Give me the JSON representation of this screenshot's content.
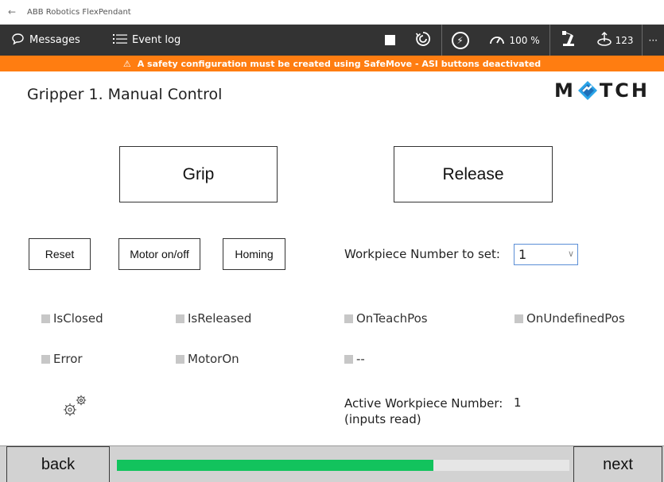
{
  "window": {
    "title": "ABB Robotics FlexPendant",
    "back_glyph": "←"
  },
  "commandbar": {
    "messages_label": "Messages",
    "messages_icon": "speech-bubble-icon",
    "eventlog_label": "Event log",
    "eventlog_icon": "list-icon",
    "speed_value": "100 %",
    "jog_value": "123",
    "more_glyph": "···"
  },
  "banner": {
    "warning_glyph": "⚠",
    "text": "A safety configuration must be created using SafeMove - ASI buttons deactivated",
    "color": "#ff7d11"
  },
  "page": {
    "title": "Gripper 1. Manual Control",
    "logo_left": "M",
    "logo_right": "TCH"
  },
  "actions": {
    "grip_label": "Grip",
    "release_label": "Release",
    "reset_label": "Reset",
    "motor_label": "Motor on/off",
    "homing_label": "Homing"
  },
  "workpiece": {
    "label": "Workpiece Number to set:",
    "selected": "1",
    "chevron": "∨"
  },
  "signals": {
    "is_closed": "IsClosed",
    "is_released": "IsReleased",
    "on_teach_pos": "OnTeachPos",
    "on_undefined_pos": "OnUndefinedPos",
    "error": "Error",
    "motor_on": "MotorOn",
    "unused": "--"
  },
  "active_workpiece": {
    "label_line1": "Active Workpiece Number:",
    "label_line2": "(inputs read)",
    "value": "1"
  },
  "navigation": {
    "back_label": "back",
    "next_label": "next",
    "progress_fraction": 0.7,
    "progress_color": "#12c35d"
  }
}
